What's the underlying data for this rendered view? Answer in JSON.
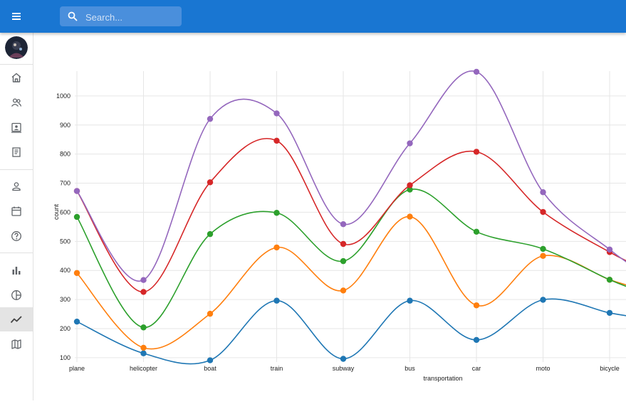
{
  "header": {
    "search_placeholder": "Search..."
  },
  "sidebar": {
    "items": [
      {
        "icon": "home-icon"
      },
      {
        "icon": "group-icon"
      },
      {
        "icon": "contact-card-icon"
      },
      {
        "icon": "book-icon"
      },
      {
        "icon": "person-icon"
      },
      {
        "icon": "calendar-icon"
      },
      {
        "icon": "help-icon"
      },
      {
        "icon": "bar-chart-icon"
      },
      {
        "icon": "pie-chart-icon"
      },
      {
        "icon": "line-chart-icon",
        "active": true
      },
      {
        "icon": "map-icon"
      }
    ]
  },
  "chart_data": {
    "type": "line",
    "xlabel": "transportation",
    "ylabel": "count",
    "ylim": [
      85,
      1100
    ],
    "yticks": [
      100,
      200,
      300,
      400,
      500,
      600,
      700,
      800,
      900,
      1000
    ],
    "categories": [
      "plane",
      "helicopter",
      "boat",
      "train",
      "subway",
      "bus",
      "car",
      "moto",
      "bicycle"
    ],
    "curve": "smooth",
    "grid": true,
    "legend": "none",
    "series": [
      {
        "color": "#1f77b4",
        "values": [
          224,
          115,
          91,
          296,
          96,
          296,
          161,
          299,
          254
        ]
      },
      {
        "color": "#ff7f0e",
        "values": [
          391,
          134,
          251,
          479,
          331,
          585,
          280,
          450,
          368
        ]
      },
      {
        "color": "#2ca02c",
        "values": [
          584,
          204,
          525,
          598,
          432,
          678,
          533,
          474,
          368
        ]
      },
      {
        "color": "#d62728",
        "values": [
          673,
          326,
          703,
          846,
          491,
          693,
          808,
          601,
          463
        ]
      },
      {
        "color": "#9467bd",
        "values": [
          673,
          367,
          921,
          940,
          559,
          837,
          1083,
          669,
          472
        ]
      }
    ]
  }
}
